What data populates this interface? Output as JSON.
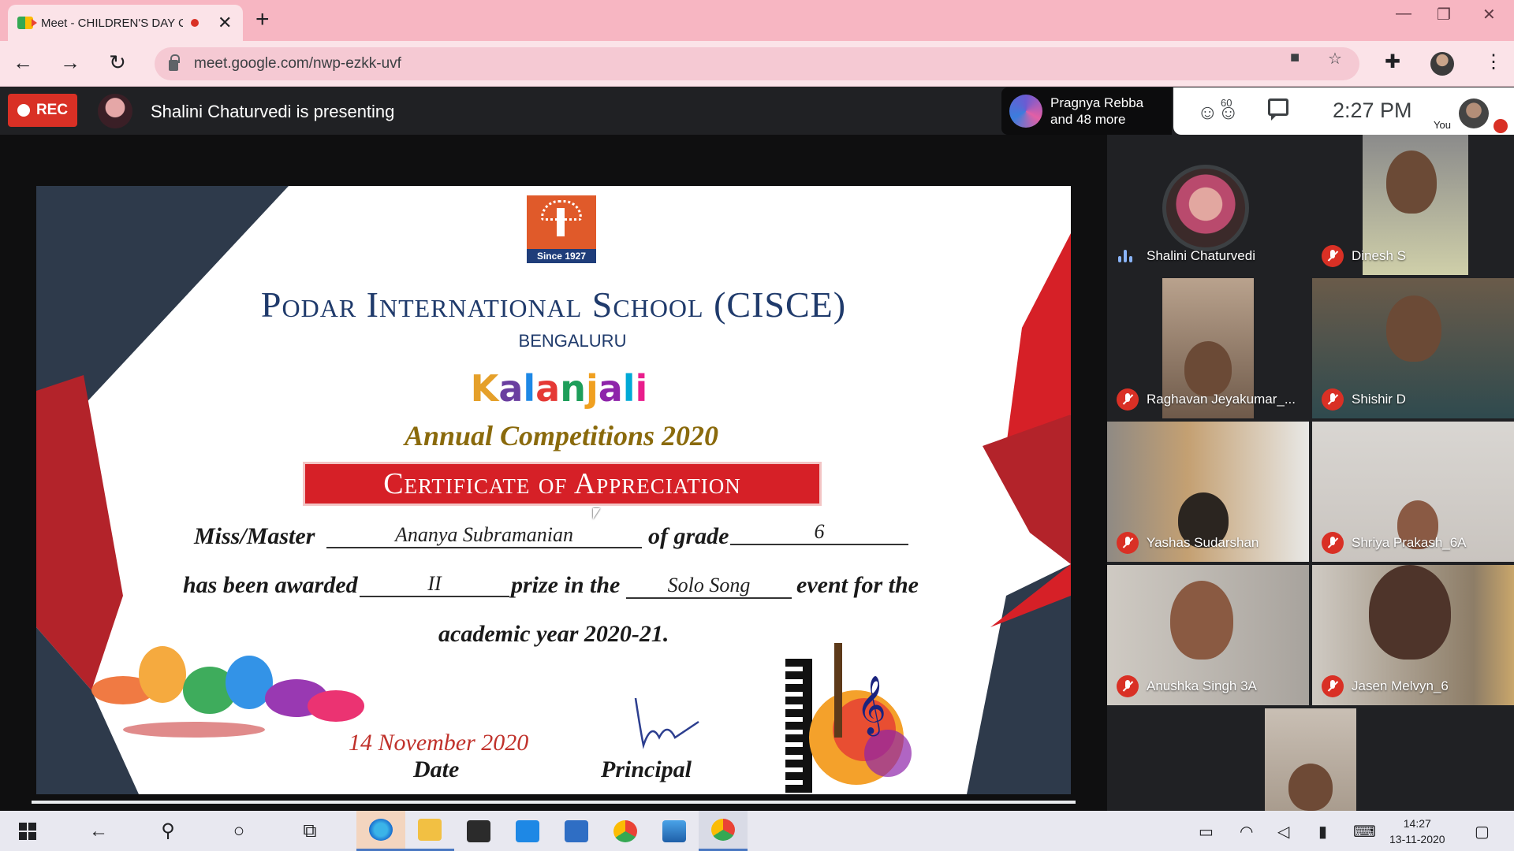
{
  "browser": {
    "tab_title": "Meet - CHILDREN'S DAY C",
    "new_tab": "+",
    "tab_close": "✕",
    "url": "meet.google.com/nwp-ezkk-uvf",
    "window_controls": [
      "—",
      "❐",
      "✕"
    ]
  },
  "meet": {
    "rec_label": "REC",
    "presenting_text": "Shalini Chaturvedi is presenting",
    "participants_line1": "Pragnya Rebba",
    "participants_line2": "and 48 more",
    "people_count": "60",
    "time": "2:27  PM",
    "you_label": "You"
  },
  "certificate": {
    "logo_caption": "Since 1927",
    "school": "Podar International School (CISCE)",
    "city": "BENGALURU",
    "brand": [
      "K",
      "a",
      "l",
      "a",
      "n",
      "j",
      "a",
      "l",
      "i"
    ],
    "brand_colors": [
      "#e5a02a",
      "#6a3fa0",
      "#1e88e5",
      "#e53935",
      "#1e9e5a",
      "#f0a020",
      "#8e24aa",
      "#00a9d6",
      "#e91e8c"
    ],
    "competition": "Annual Competitions 2020",
    "banner": "Certificate of Appreciation",
    "line1_prefix": "Miss/Master",
    "student_name": "Ananya Subramanian",
    "line1_mid": "of grade",
    "grade": "6",
    "line2_prefix": "has been awarded",
    "prize": "II",
    "line2_mid": "prize in the",
    "event": "Solo Song",
    "line2_suffix": "event for the",
    "line3": "academic year 2020-21.",
    "date_value": "14 November 2020",
    "date_label": "Date",
    "principal_label": "Principal"
  },
  "participants": [
    {
      "name": "Shalini Chaturvedi",
      "muted": false
    },
    {
      "name": "Dinesh S",
      "muted": true
    },
    {
      "name": "Raghavan Jeyakumar_...",
      "muted": true
    },
    {
      "name": "Shishir D",
      "muted": true
    },
    {
      "name": "Yashas Sudarshan",
      "muted": true
    },
    {
      "name": "Shriya Prakash_6A",
      "muted": true
    },
    {
      "name": "Anushka Singh 3A",
      "muted": true
    },
    {
      "name": "Jasen Melvyn_6",
      "muted": true
    }
  ],
  "taskbar": {
    "time": "14:27",
    "date": "13-11-2020"
  },
  "colors": {
    "recording_red": "#d93025",
    "chrome_pink": "#f7b6c2",
    "meet_dark": "#202124",
    "certificate_banner": "#d62027"
  }
}
